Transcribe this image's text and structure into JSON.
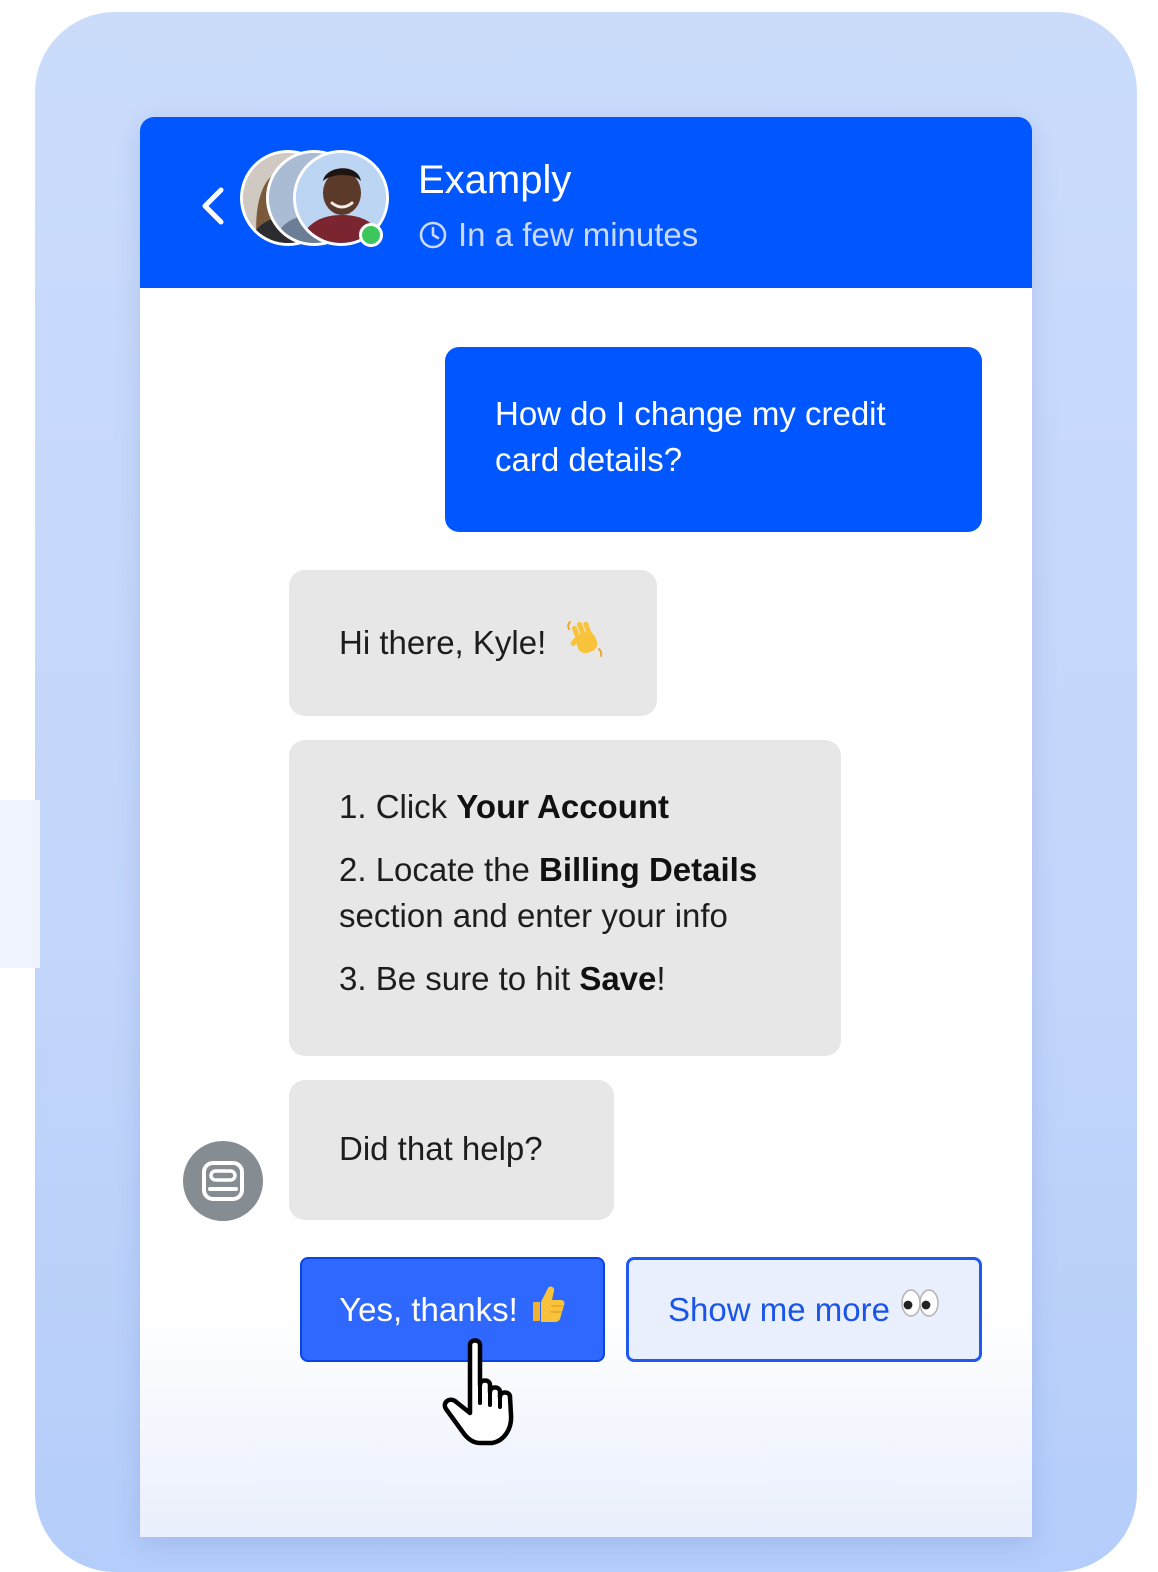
{
  "header": {
    "team_name": "Examply",
    "reply_time": "In a few minutes"
  },
  "messages": {
    "user_question": "How do I change my credit card details?",
    "greeting": "Hi there, Kyle!",
    "steps": [
      {
        "prefix": "1. Click ",
        "bold": "Your Account",
        "suffix": ""
      },
      {
        "prefix": "2. Locate the ",
        "bold": "Billing Details",
        "suffix": " section and enter your info"
      },
      {
        "prefix": "3. Be sure to hit ",
        "bold": "Save",
        "suffix": "!"
      }
    ],
    "follow_up": "Did that help?"
  },
  "quick_replies": {
    "yes_label": "Yes, thanks!",
    "more_label": "Show me more"
  },
  "colors": {
    "brand_blue": "#0057ff",
    "bot_bubble": "#e7e7e7",
    "online_green": "#3cc65b",
    "panel_bg": "#c3d6fb"
  },
  "icons": [
    "back-chevron-icon",
    "clock-icon",
    "waving-hand-emoji",
    "thumbs-up-emoji",
    "eyes-emoji",
    "bot-icon",
    "hand-pointer-cursor-icon"
  ]
}
